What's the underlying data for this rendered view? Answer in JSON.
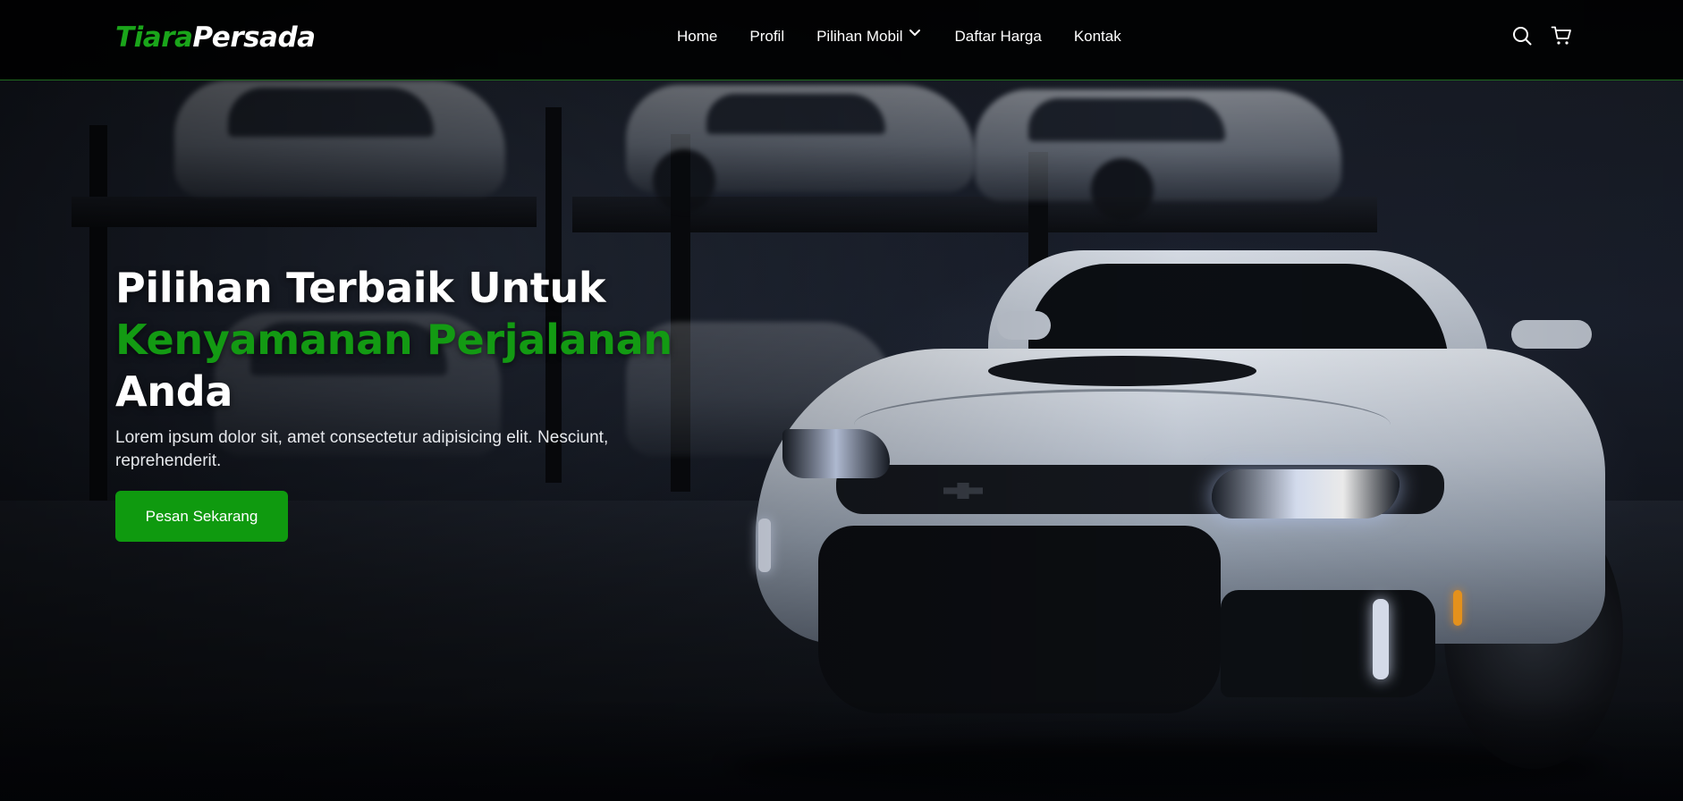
{
  "brand": {
    "part1": "Tiara",
    "part2": "Persada"
  },
  "nav": {
    "items": [
      {
        "label": "Home"
      },
      {
        "label": "Profil"
      },
      {
        "label": "Pilihan Mobil"
      },
      {
        "label": "Daftar Harga"
      },
      {
        "label": "Kontak"
      }
    ],
    "dropdown_icon": "chevron-down-icon",
    "icons": [
      "search-icon",
      "cart-icon"
    ]
  },
  "hero": {
    "title_line1": "Pilihan Terbaik Untuk",
    "title_line2": "Kenyamanan Perjalanan",
    "title_line3": "Anda",
    "description": "Lorem ipsum dolor sit, amet consectetur adipisicing elit. Nesciunt, reprehenderit.",
    "cta_label": "Pesan Sekarang"
  },
  "colors": {
    "accent": "#139a13",
    "navbar_bg": "#000000",
    "text": "#ffffff"
  }
}
